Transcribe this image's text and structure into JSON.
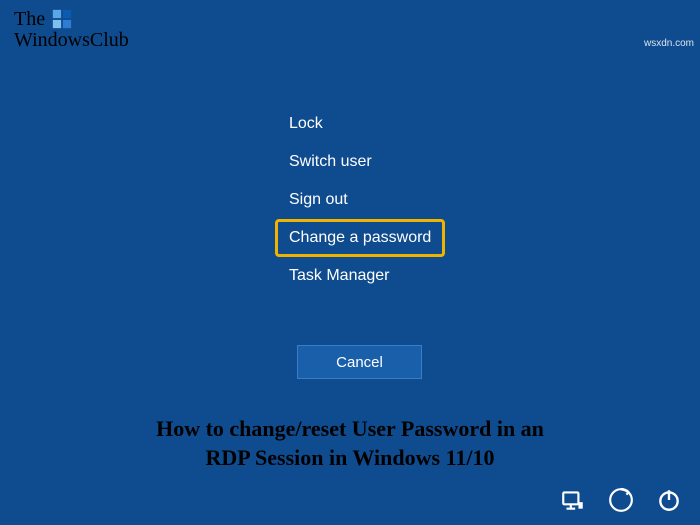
{
  "logo": {
    "line1": "The",
    "line2": "WindowsClub"
  },
  "watermark": "wsxdn.com",
  "menu": {
    "items": [
      {
        "label": "Lock",
        "highlighted": false
      },
      {
        "label": "Switch user",
        "highlighted": false
      },
      {
        "label": "Sign out",
        "highlighted": false
      },
      {
        "label": "Change a password",
        "highlighted": true
      },
      {
        "label": "Task Manager",
        "highlighted": false
      }
    ]
  },
  "cancel_label": "Cancel",
  "caption": {
    "line1": "How to change/reset User Password in an",
    "line2": "RDP Session in Windows 11/10"
  },
  "tray": {
    "network": "network-icon",
    "ease": "ease-of-access-icon",
    "power": "power-icon"
  }
}
